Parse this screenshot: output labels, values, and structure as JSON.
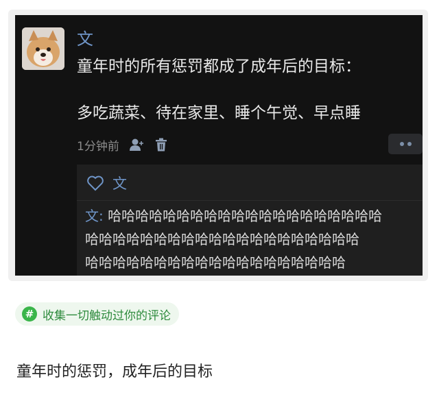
{
  "post": {
    "author": "文",
    "text_line1": "童年时的所有惩罚都成了成年后的目标：",
    "text_line2": "多吃蔬菜、待在家里、睡个午觉、早点睡",
    "time": "1分钟前",
    "icons": [
      "person-icon",
      "trash-icon",
      "more-dots-icon"
    ]
  },
  "reply": {
    "liker": "文",
    "comment_author": "文:",
    "comment_line1_rest": " 哈哈哈哈哈哈哈哈哈哈哈哈哈哈哈哈哈哈哈哈",
    "comment_line2": "哈哈哈哈哈哈哈哈哈哈哈哈哈哈哈哈哈哈哈哈",
    "comment_line3": "哈哈哈哈哈哈哈哈哈哈哈哈哈哈哈哈哈哈哈"
  },
  "tag": {
    "icon": "hash-icon",
    "label": "收集一切触动过你的评论",
    "color": "#3ab54a"
  },
  "caption": "童年时的惩罚，成年后的目标"
}
